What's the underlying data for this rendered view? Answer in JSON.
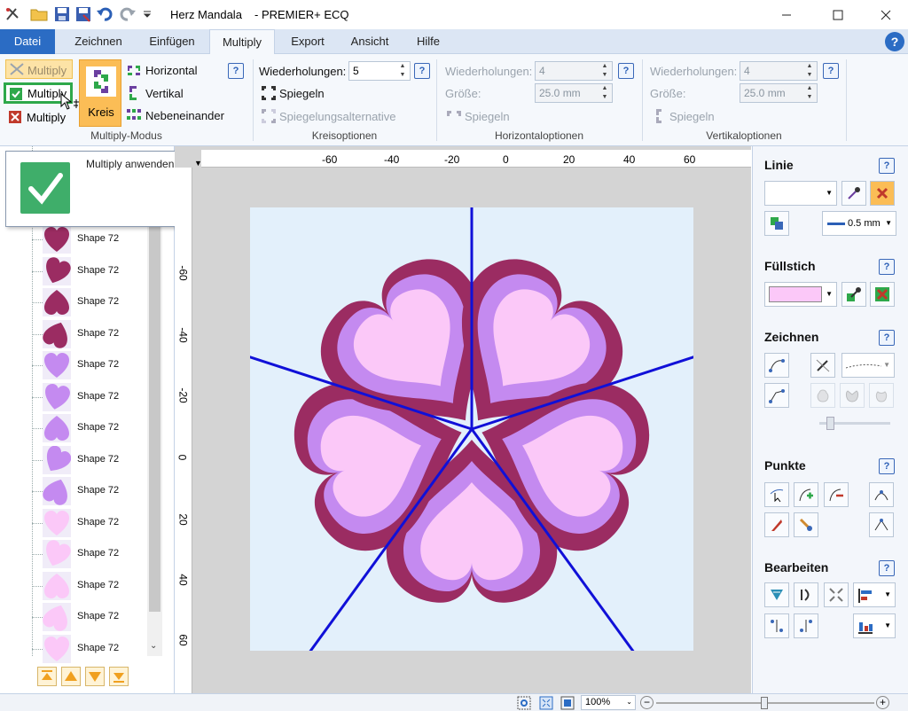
{
  "title_bar": {
    "doc_name": "Herz Mandala",
    "app_name": "- PREMIER+ ECQ"
  },
  "tabs": [
    {
      "label": "Datei"
    },
    {
      "label": "Zeichnen"
    },
    {
      "label": "Einfügen"
    },
    {
      "label": "Multiply"
    },
    {
      "label": "Export"
    },
    {
      "label": "Ansicht"
    },
    {
      "label": "Hilfe"
    }
  ],
  "ribbon": {
    "multiply_mode": {
      "btn_multiply_top": "Multiply",
      "btn_multiply_apply": "Multiply",
      "btn_multiply_cancel": "Multiply",
      "kreis": "Kreis",
      "horizontal": "Horizontal",
      "vertikal": "Vertikal",
      "nebeneinander": "Nebeneinander",
      "group_label": "Multiply-Modus"
    },
    "kreisoptionen": {
      "wiederholungen_label": "Wiederholungen:",
      "wiederholungen_value": "5",
      "spiegeln": "Spiegeln",
      "spiegelungsalternative": "Spiegelungsalternative",
      "group_label": "Kreisoptionen"
    },
    "horizontaloptionen": {
      "wiederholungen_label": "Wiederholungen:",
      "wiederholungen_value": "4",
      "groesse_label": "Größe:",
      "groesse_value": "25.0 mm",
      "spiegeln": "Spiegeln",
      "group_label": "Horizontaloptionen"
    },
    "vertikaloptionen": {
      "wiederholungen_label": "Wiederholungen:",
      "wiederholungen_value": "4",
      "groesse_label": "Größe:",
      "groesse_value": "25.0 mm",
      "spiegeln": "Spiegeln",
      "group_label": "Vertikaloptionen"
    },
    "help": "?"
  },
  "tooltip": {
    "text": "Multiply anwenden"
  },
  "shape_list": {
    "items": [
      {
        "label": "Shape 72",
        "color": "#9b2c62"
      },
      {
        "label": "Shape 72",
        "color": "#9b2c62"
      },
      {
        "label": "Shape 72",
        "color": "#9b2c62"
      },
      {
        "label": "Shape 72",
        "color": "#9b2c62"
      },
      {
        "label": "Shape 72",
        "color": "#c48af0"
      },
      {
        "label": "Shape 72",
        "color": "#c48af0"
      },
      {
        "label": "Shape 72",
        "color": "#c48af0"
      },
      {
        "label": "Shape 72",
        "color": "#c48af0"
      },
      {
        "label": "Shape 72",
        "color": "#c48af0"
      },
      {
        "label": "Shape 72",
        "color": "#fbc8f8"
      },
      {
        "label": "Shape 72",
        "color": "#fbc8f8"
      },
      {
        "label": "Shape 72",
        "color": "#fbc8f8"
      },
      {
        "label": "Shape 72",
        "color": "#fbc8f8"
      },
      {
        "label": "Shape 72",
        "color": "#fbc8f8"
      }
    ]
  },
  "ruler": {
    "h_ticks": [
      "-60",
      "-40",
      "-20",
      "0",
      "20",
      "40",
      "60"
    ],
    "v_ticks": [
      "-60",
      "-40",
      "-20",
      "0",
      "20",
      "40",
      "60"
    ]
  },
  "right_panel": {
    "linie": "Linie",
    "line_width": "0.5 mm",
    "fuellstich": "Füllstich",
    "zeichnen": "Zeichnen",
    "punkte": "Punkte",
    "bearbeiten": "Bearbeiten",
    "fill_color": "#fbc8f8"
  },
  "status_bar": {
    "zoom": "100%"
  },
  "colors": {
    "heart_outer": "#9b2c62",
    "heart_middle": "#c48af0",
    "heart_inner": "#fbc8f8",
    "spoke": "#1010d8",
    "canvas_bg": "#e3f0fb"
  }
}
